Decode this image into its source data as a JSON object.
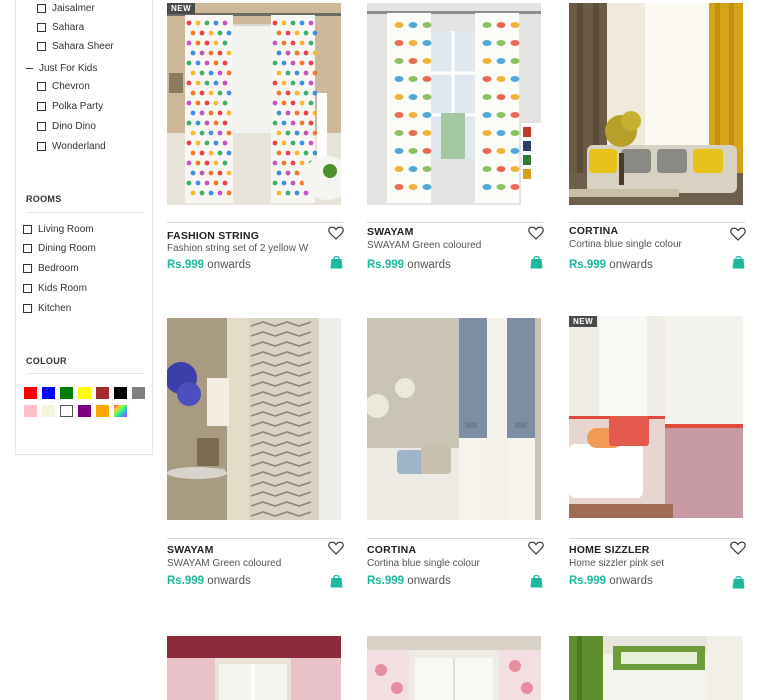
{
  "sidebar": {
    "fabric_items": [
      {
        "label": "Jaisalmer"
      },
      {
        "label": "Sahara"
      },
      {
        "label": "Sahara Sheer"
      }
    ],
    "group_label": "Just For Kids",
    "kids_items": [
      {
        "label": "Chevron"
      },
      {
        "label": "Polka Party"
      },
      {
        "label": "Dino Dino"
      },
      {
        "label": "Wonderland"
      }
    ],
    "rooms_title": "ROOMS",
    "rooms": [
      {
        "label": "Living Room"
      },
      {
        "label": "Dining Room"
      },
      {
        "label": "Bedroom"
      },
      {
        "label": "Kids Room"
      },
      {
        "label": "Kitchen"
      }
    ],
    "colour_title": "COLOUR",
    "colours": [
      "#ff0000",
      "#0000ff",
      "#008000",
      "#ffff00",
      "#a52a2a",
      "#000000",
      "#808080",
      "#ffc0cb",
      "#f5f5dc",
      "#ffffff",
      "#800080",
      "#ffa500",
      "multicolor"
    ]
  },
  "products": [
    {
      "badge": "NEW",
      "title": "FASHION STRING",
      "subtitle": "Fashion string set of 2 yellow W",
      "price": "Rs.999",
      "price_suffix": "onwards"
    },
    {
      "badge": "",
      "title": "SWAYAM",
      "subtitle": "SWAYAM Green coloured",
      "price": "Rs.999",
      "price_suffix": "onwards"
    },
    {
      "badge": "",
      "title": "CORTINA",
      "subtitle": "Cortina blue single colour",
      "price": "Rs.999",
      "price_suffix": "onwards"
    },
    {
      "badge": "",
      "title": "SWAYAM",
      "subtitle": "SWAYAM Green coloured",
      "price": "Rs.999",
      "price_suffix": "onwards"
    },
    {
      "badge": "",
      "title": "CORTINA",
      "subtitle": "Cortina blue single colour",
      "price": "Rs.999",
      "price_suffix": "onwards"
    },
    {
      "badge": "NEW",
      "title": "HOME SIZZLER",
      "subtitle": "Home sizzler pink set",
      "price": "Rs.999",
      "price_suffix": "onwards"
    }
  ],
  "icons": {
    "wishlist": "heart-outline-icon",
    "cart": "shopping-bag-icon"
  },
  "colors": {
    "accent": "#1bb89e",
    "badge_bg": "#4a4a4a"
  }
}
